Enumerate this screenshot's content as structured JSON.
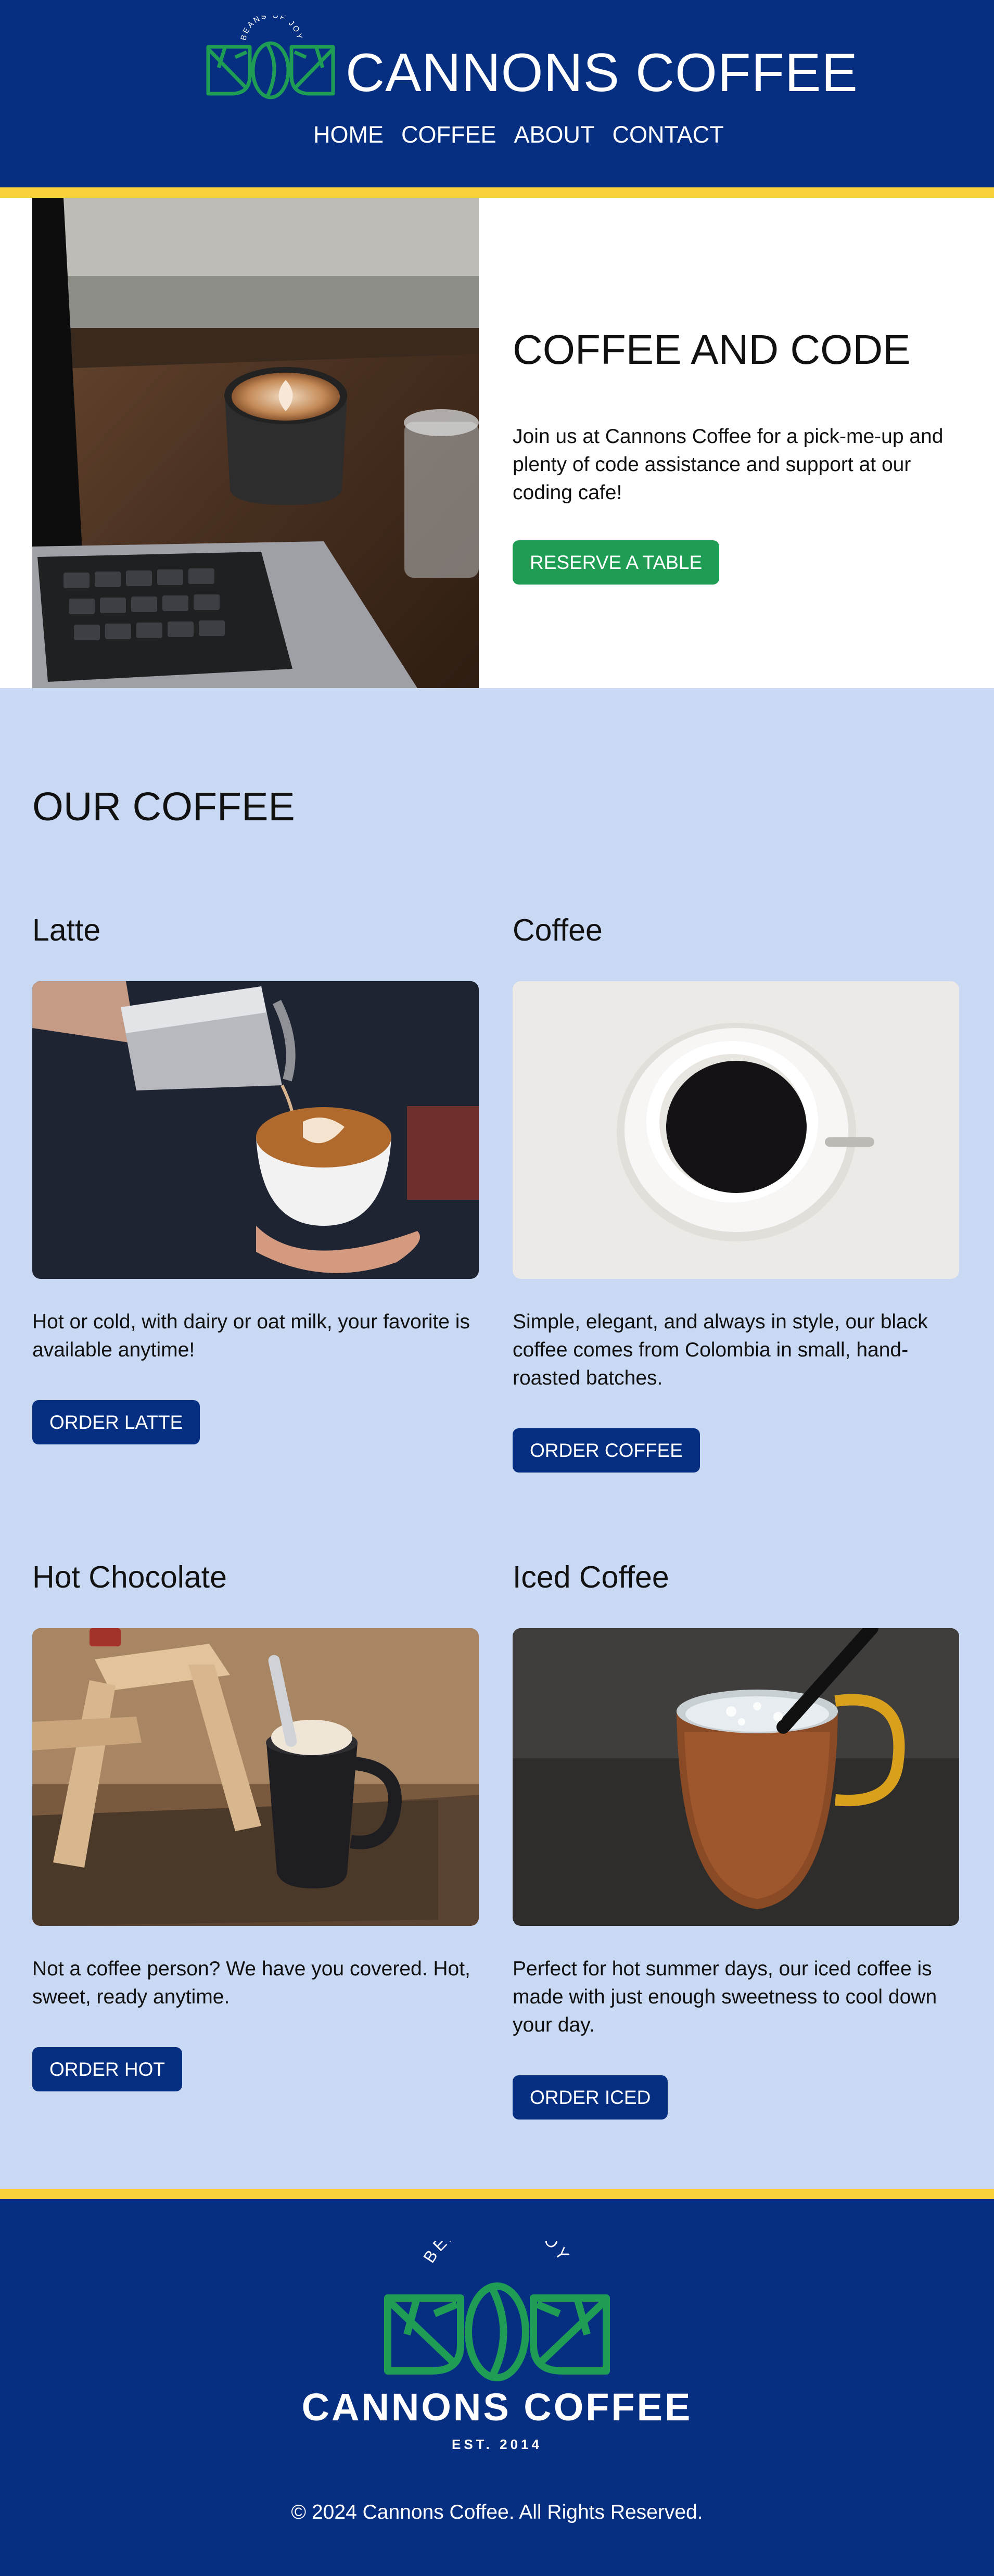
{
  "brand": {
    "name": "CANNONS COFFEE",
    "tagline": "BEANS OF JOY",
    "established": "EST. 2014"
  },
  "nav": {
    "items": [
      "HOME",
      "COFFEE",
      "ABOUT",
      "CONTACT"
    ]
  },
  "hero": {
    "title": "COFFEE AND CODE",
    "text": "Join us at Cannons Coffee for a pick-me-up and plenty of code assistance and support at our coding cafe!",
    "cta_label": "RESERVE A TABLE"
  },
  "menu": {
    "title": "OUR COFFEE",
    "cards": [
      {
        "name": "Latte",
        "description": "Hot or cold, with dairy or oat milk, your favorite is available anytime!",
        "button": "ORDER LATTE"
      },
      {
        "name": "Coffee",
        "description": "Simple, elegant, and always in style, our black coffee comes from Colombia in small, hand-roasted batches.",
        "button": "ORDER COFFEE"
      },
      {
        "name": "Hot Chocolate",
        "description": "Not a coffee person? We have you covered. Hot, sweet, ready anytime.",
        "button": "ORDER HOT"
      },
      {
        "name": "Iced Coffee",
        "description": "Perfect for hot summer days, our iced coffee is made with just enough sweetness to cool down your day.",
        "button": "ORDER ICED"
      }
    ]
  },
  "footer": {
    "copyright": "© 2024 Cannons Coffee. All Rights Reserved."
  },
  "colors": {
    "navy": "#062f81",
    "accent_yellow": "#f8d23a",
    "light_blue": "#c9d9f4",
    "green": "#1f9d55"
  }
}
